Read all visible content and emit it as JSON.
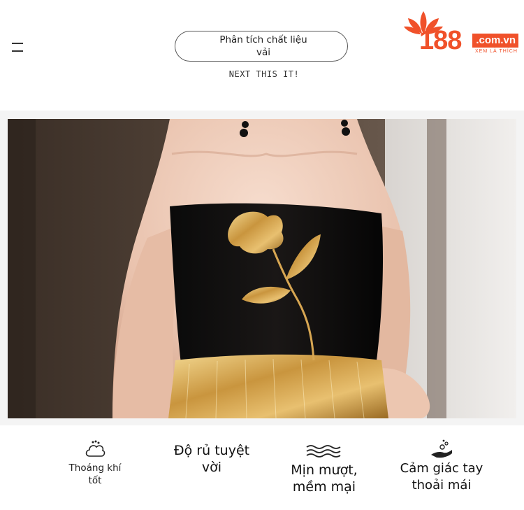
{
  "header": {
    "title": "Phân tích chất liệu vải",
    "tagline": "NEXT THIS IT!",
    "menu_icon": "hamburger-menu-icon"
  },
  "logo": {
    "number": "188",
    "domain": ".com.vn",
    "slogan": "XEM LÀ THÍCH",
    "brand_color": "#f0512a"
  },
  "features": [
    {
      "icon": "cloud-breathable-icon",
      "label": "Thoáng khí tốt"
    },
    {
      "icon": "",
      "label": "Độ rủ tuyệt vời"
    },
    {
      "icon": "waves-smooth-icon",
      "label": "Mịn mượt, mềm mại"
    },
    {
      "icon": "hand-comfort-icon",
      "label": "Cảm giác tay thoải mái"
    }
  ]
}
